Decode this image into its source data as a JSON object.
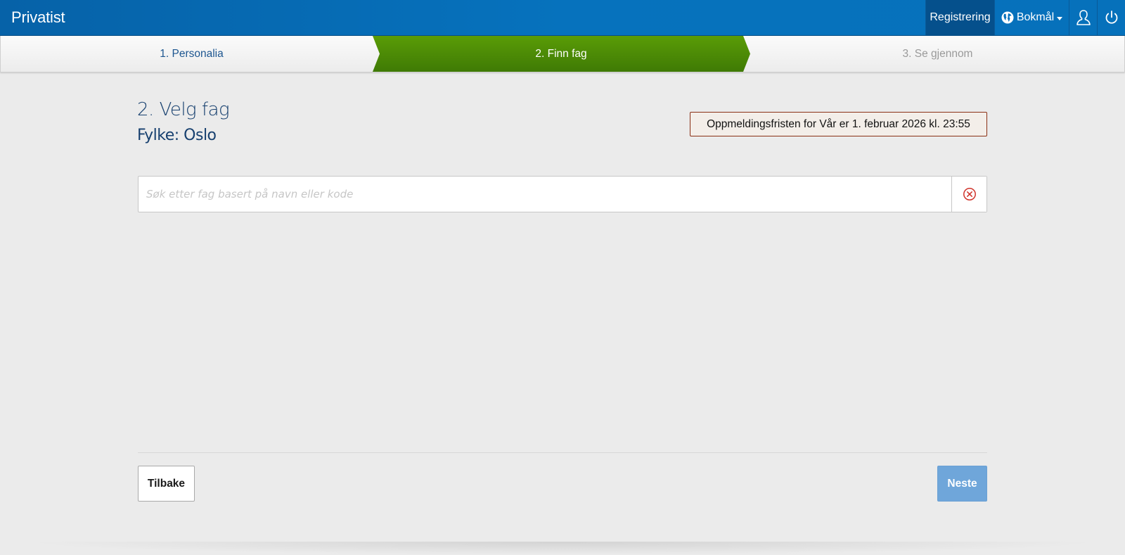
{
  "navbar": {
    "brand": "Privatist",
    "registration_label": "Registrering",
    "language_label": "Bokmål",
    "icons": [
      "globe-icon",
      "caret-down-icon",
      "user-icon",
      "power-icon"
    ]
  },
  "steps": [
    {
      "label": "1. Personalia",
      "state": "done"
    },
    {
      "label": "2. Finn fag",
      "state": "active"
    },
    {
      "label": "3. Se gjennom",
      "state": "pending"
    }
  ],
  "page": {
    "title": "2. Velg fag",
    "county": "Fylke: Oslo",
    "deadline": "Oppmeldingsfristen for Vår er 1. februar 2026 kl. 23:55"
  },
  "search": {
    "value": "",
    "placeholder": "Søk etter fag basert på navn eller kode",
    "clear_icon": "clear-circle-icon"
  },
  "footer": {
    "back_label": "Tilbake",
    "next_label": "Neste"
  },
  "colors": {
    "nav_blue": "#0672bd",
    "active_step_green": "#4e8f06",
    "title_blue": "#17406f",
    "next_button": "#6fa6da",
    "deadline_border": "#8a2f14",
    "clear_icon": "#d0342c"
  }
}
